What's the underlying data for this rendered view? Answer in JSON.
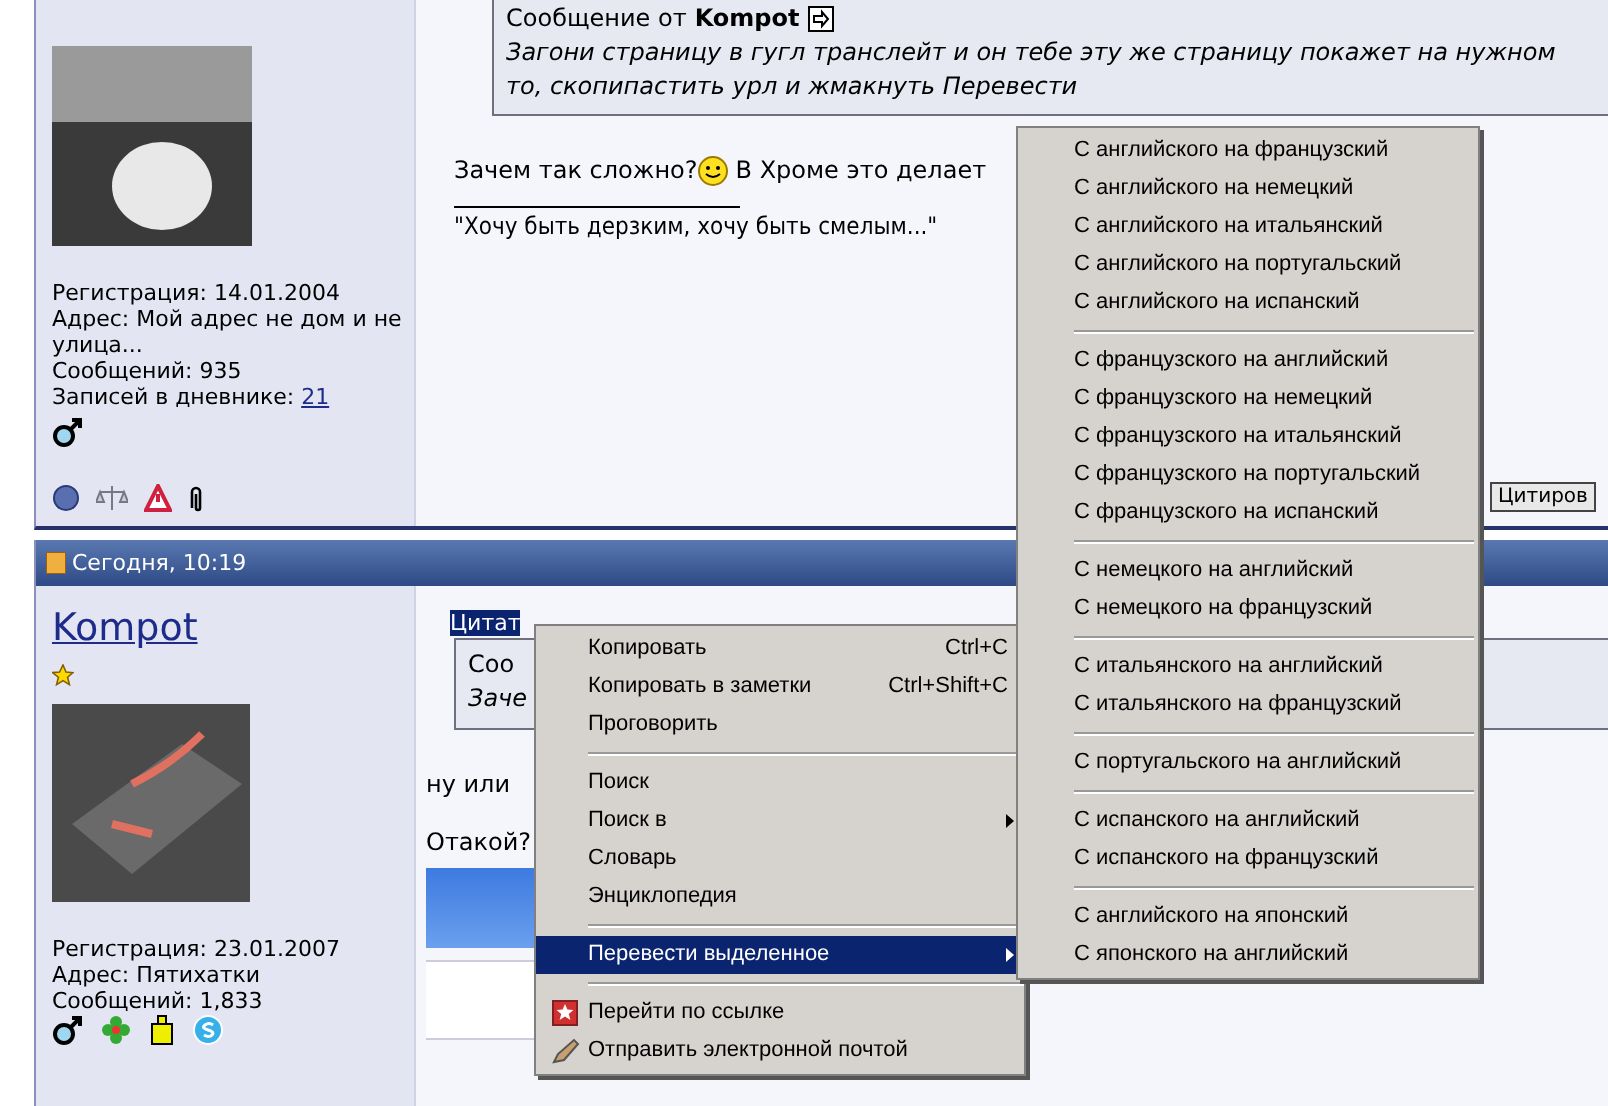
{
  "post_top": {
    "user": {
      "info": [
        "Регистрация: 14.01.2004",
        "Адрес: Мой адрес не дом и не улица...",
        "Сообщений: 935"
      ],
      "diary_label": "Записей в дневнике:",
      "diary_count": "21"
    },
    "quote": {
      "prefix": "Сообщение от",
      "author": "Kompot",
      "lines": [
        "Загони страницу в гугл транслейт и он тебе эту же страницу покажет на нужном",
        "то, скопипастить урл и жмакнуть Перевести"
      ]
    },
    "message_start": "Зачем так сложно?",
    "message_end": "В Хроме это делает",
    "signature": "\"Хочу быть дерзким, хочу быть смелым...\"",
    "quote_button": "Цитиров"
  },
  "post_bottom": {
    "date": "Сегодня, 10:19",
    "username": "Kompot",
    "info": [
      "Регистрация: 23.01.2007",
      "Адрес: Пятихатки",
      "Сообщений: 1,833"
    ],
    "quote_label": "Цитат",
    "quote_lines": [
      "Соо",
      "Заче"
    ],
    "message": "ну или",
    "question": "Отакой?"
  },
  "context_menu": {
    "groups": [
      [
        {
          "kind": "plain",
          "label": "Копировать",
          "shortcut": "Ctrl+C",
          "selected": false
        },
        {
          "kind": "plain",
          "label": "Копировать в заметки",
          "shortcut": "Ctrl+Shift+C",
          "selected": false
        },
        {
          "kind": "plain",
          "label": "Проговорить",
          "selected": false
        }
      ],
      [
        {
          "kind": "plain",
          "label": "Поиск",
          "selected": false
        },
        {
          "kind": "submenu",
          "label": "Поиск в",
          "selected": false
        },
        {
          "kind": "plain",
          "label": "Словарь",
          "selected": false
        },
        {
          "kind": "plain",
          "label": "Энциклопедия",
          "selected": false
        }
      ],
      [
        {
          "kind": "submenu",
          "label": "Перевести выделенное",
          "selected": true
        }
      ],
      [
        {
          "kind": "bookmark",
          "label": "Перейти по ссылке",
          "selected": false
        },
        {
          "kind": "mail",
          "label": "Отправить электронной почтой",
          "selected": false
        }
      ]
    ]
  },
  "translate_menu": {
    "groups": [
      [
        "С английского на французский",
        "С английского на немецкий",
        "С английского на итальянский",
        "С английского на португальский",
        "С английского на испанский"
      ],
      [
        "С французского на английский",
        "С французского на немецкий",
        "С французского на итальянский",
        "С французского на португальский",
        "С французского на испанский"
      ],
      [
        "С немецкого на английский",
        "С немецкого на французский"
      ],
      [
        "С итальянского на английский",
        "С итальянского на французский"
      ],
      [
        "С португальского на английский"
      ],
      [
        "С испанского на английский",
        "С испанского на французский"
      ],
      [
        "С английского на японский",
        "С японского на английский"
      ]
    ]
  }
}
